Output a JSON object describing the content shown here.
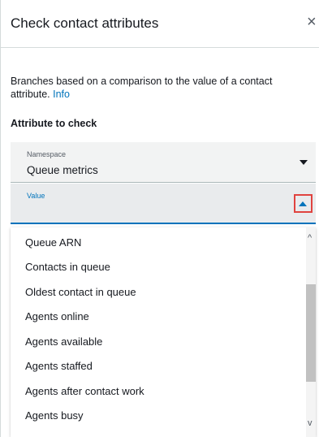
{
  "panel": {
    "title": "Check contact attributes",
    "close_glyph": "×",
    "description": "Branches based on a comparison to the value of a contact attribute.",
    "info_link": "Info",
    "section_label": "Attribute to check"
  },
  "namespace": {
    "label": "Namespace",
    "value": "Queue metrics",
    "icon": "chevron-down-icon"
  },
  "value_field": {
    "label": "Value",
    "value": "",
    "icon": "chevron-up-icon",
    "highlight_color": "#e0433f",
    "focus_color": "#0073bb"
  },
  "dropdown": {
    "options": [
      "Queue ARN",
      "Contacts in queue",
      "Oldest contact in queue",
      "Agents online",
      "Agents available",
      "Agents staffed",
      "Agents after contact work",
      "Agents busy"
    ],
    "scroll_up_glyph": "^",
    "scroll_down_glyph": "v"
  }
}
